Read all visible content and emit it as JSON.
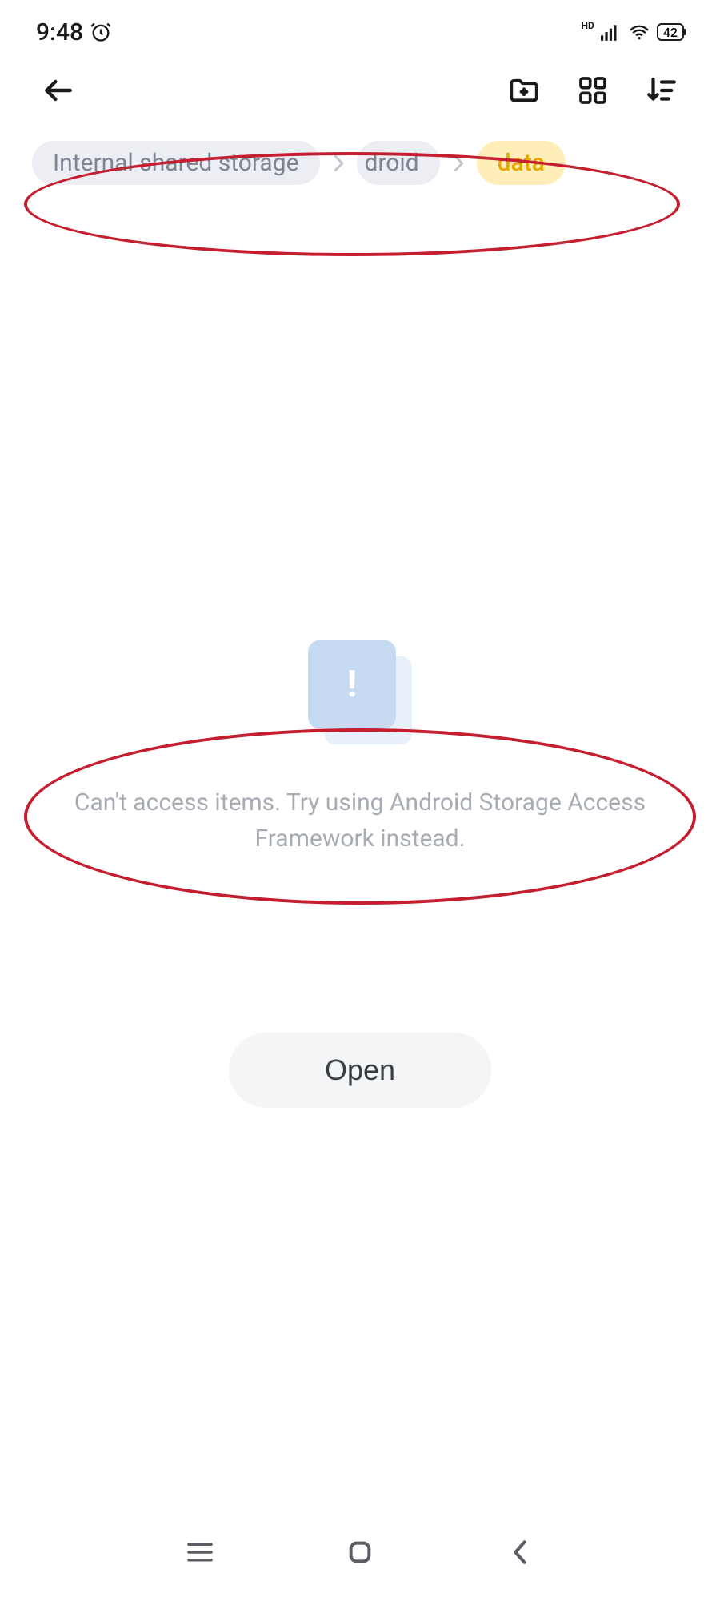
{
  "status": {
    "time": "9:48",
    "hd_label": "HD",
    "battery": "42"
  },
  "breadcrumb": {
    "items": [
      {
        "label": "Internal shared storage",
        "active": false
      },
      {
        "label": "droid",
        "active": false
      },
      {
        "label": "data",
        "active": true
      }
    ]
  },
  "empty": {
    "message": "Can't access items. Try using Android Storage Access Framework instead."
  },
  "actions": {
    "open_label": "Open"
  }
}
